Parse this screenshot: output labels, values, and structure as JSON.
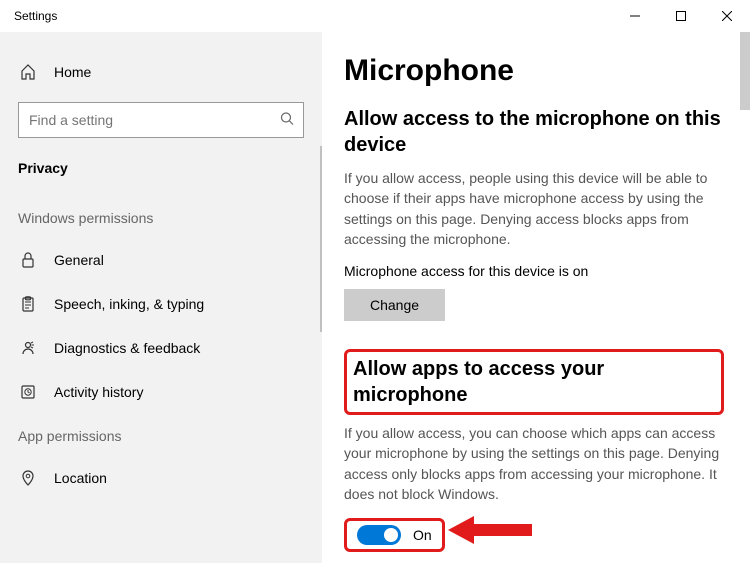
{
  "window": {
    "title": "Settings"
  },
  "sidebar": {
    "home": "Home",
    "search_placeholder": "Find a setting",
    "category": "Privacy",
    "sections": {
      "windows_permissions": "Windows permissions",
      "app_permissions": "App permissions"
    },
    "items": {
      "general": "General",
      "speech": "Speech, inking, & typing",
      "diagnostics": "Diagnostics & feedback",
      "activity": "Activity history",
      "location": "Location"
    }
  },
  "page": {
    "title": "Microphone",
    "device_access": {
      "heading": "Allow access to the microphone on this device",
      "body": "If you allow access, people using this device will be able to choose if their apps have microphone access by using the settings on this page. Denying access blocks apps from accessing the microphone.",
      "status": "Microphone access for this device is on",
      "change_button": "Change"
    },
    "app_access": {
      "heading": "Allow apps to access your microphone",
      "body": "If you allow access, you can choose which apps can access your microphone by using the settings on this page. Denying access only blocks apps from accessing your microphone. It does not block Windows.",
      "toggle_state": "On"
    }
  }
}
